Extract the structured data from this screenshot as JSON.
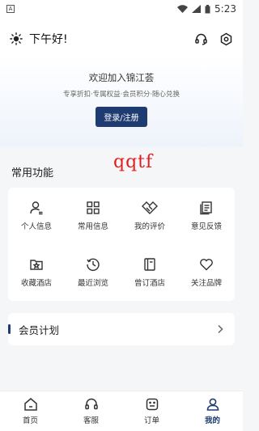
{
  "status_bar": {
    "app_badge": "A",
    "time": "5:23"
  },
  "header": {
    "greeting": "下午好!"
  },
  "promo": {
    "title": "欢迎加入锦江荟",
    "subtitle": "专享折扣·专属权益·会员积分·随心兑换",
    "login_label": "登录/注册"
  },
  "watermark": "qqtf",
  "functions": {
    "title": "常用功能",
    "items": [
      {
        "label": "个人信息",
        "icon": "person-icon"
      },
      {
        "label": "常用信息",
        "icon": "grid-icon"
      },
      {
        "label": "我的评价",
        "icon": "handshake-icon"
      },
      {
        "label": "意见反馈",
        "icon": "document-icon"
      },
      {
        "label": "收藏酒店",
        "icon": "folder-star-icon"
      },
      {
        "label": "最近浏览",
        "icon": "history-icon"
      },
      {
        "label": "曾订酒店",
        "icon": "book-icon"
      },
      {
        "label": "关注品牌",
        "icon": "heart-icon"
      }
    ]
  },
  "member": {
    "label": "会员计划"
  },
  "tabs": [
    {
      "label": "首页",
      "icon": "home-icon"
    },
    {
      "label": "客服",
      "icon": "headset-icon"
    },
    {
      "label": "订单",
      "icon": "order-icon"
    },
    {
      "label": "我的",
      "icon": "profile-icon",
      "active": true
    }
  ],
  "colors": {
    "accent": "#1e3c72",
    "watermark": "#e51c1c"
  }
}
